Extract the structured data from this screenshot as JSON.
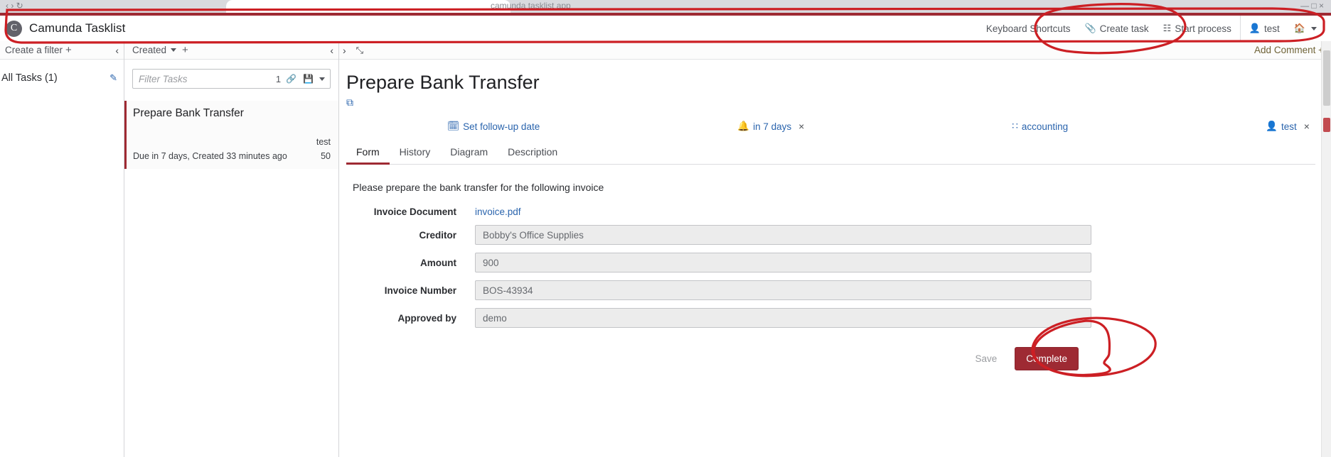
{
  "browser": {
    "ghost_tab_text": "camunda tasklist app",
    "ghost_left_icons": "‹  ›  ↻",
    "ghost_right_icons": "—  □  ×"
  },
  "header": {
    "logo_glyph": "C",
    "title": "Camunda Tasklist",
    "nav": [
      {
        "label": "Keyboard Shortcuts",
        "icon": "",
        "icon_name": "none"
      },
      {
        "label": "Create task",
        "icon": "📎",
        "icon_name": "paperclip-icon"
      },
      {
        "label": "Start process",
        "icon": "☷",
        "icon_name": "list-icon"
      },
      {
        "label": "test",
        "icon": "👤",
        "icon_name": "user-icon"
      },
      {
        "label": "",
        "icon": "🏠",
        "icon_name": "home-icon"
      }
    ]
  },
  "filter_pane": {
    "bar_label": "Create a filter",
    "bar_plus": "+",
    "collapse_icon": "‹",
    "filters": [
      {
        "label": "All Tasks (1)",
        "edit_icon": "✎"
      }
    ]
  },
  "tasklist_pane": {
    "sort_label": "Created",
    "sort_plus": "+",
    "collapse_icon": "‹",
    "search_placeholder": "Filter Tasks",
    "search_value": "",
    "result_count": "1",
    "link_icon": "🔗",
    "save_icon": "💾",
    "tasks": [
      {
        "title": "Prepare Bank Transfer",
        "assignee": "test",
        "meta": "Due in 7 days, Created 33 minutes ago",
        "priority": "50"
      }
    ]
  },
  "detail": {
    "expand_left_icon": "›",
    "fullscreen_icon": "⤡",
    "add_comment_label": "Add Comment",
    "add_comment_plus": "+",
    "title": "Prepare Bank Transfer",
    "external_link_icon": "⧉",
    "meta": {
      "follow_up_label": "Set follow-up date",
      "follow_up_icon": "🗓",
      "due_label": "in 7 days",
      "due_icon": "🔔",
      "due_remove": "×",
      "group_label": "accounting",
      "group_icon": "∷",
      "assignee_label": "test",
      "assignee_icon": "👤",
      "assignee_remove": "×"
    },
    "tabs": [
      {
        "label": "Form",
        "active": true
      },
      {
        "label": "History",
        "active": false
      },
      {
        "label": "Diagram",
        "active": false
      },
      {
        "label": "Description",
        "active": false
      }
    ],
    "form": {
      "intro": "Please prepare the bank transfer for the following invoice",
      "fields": [
        {
          "label": "Invoice Document",
          "type": "link",
          "value": "invoice.pdf"
        },
        {
          "label": "Creditor",
          "type": "input",
          "value": "Bobby's Office Supplies"
        },
        {
          "label": "Amount",
          "type": "input",
          "value": "900"
        },
        {
          "label": "Invoice Number",
          "type": "input",
          "value": "BOS-43934"
        },
        {
          "label": "Approved by",
          "type": "input",
          "value": "demo"
        }
      ],
      "save_label": "Save",
      "complete_label": "Complete"
    }
  },
  "colors": {
    "brand_red": "#9e2a33",
    "link_blue": "#2a64ad",
    "annotation_red": "#cc1f24"
  }
}
